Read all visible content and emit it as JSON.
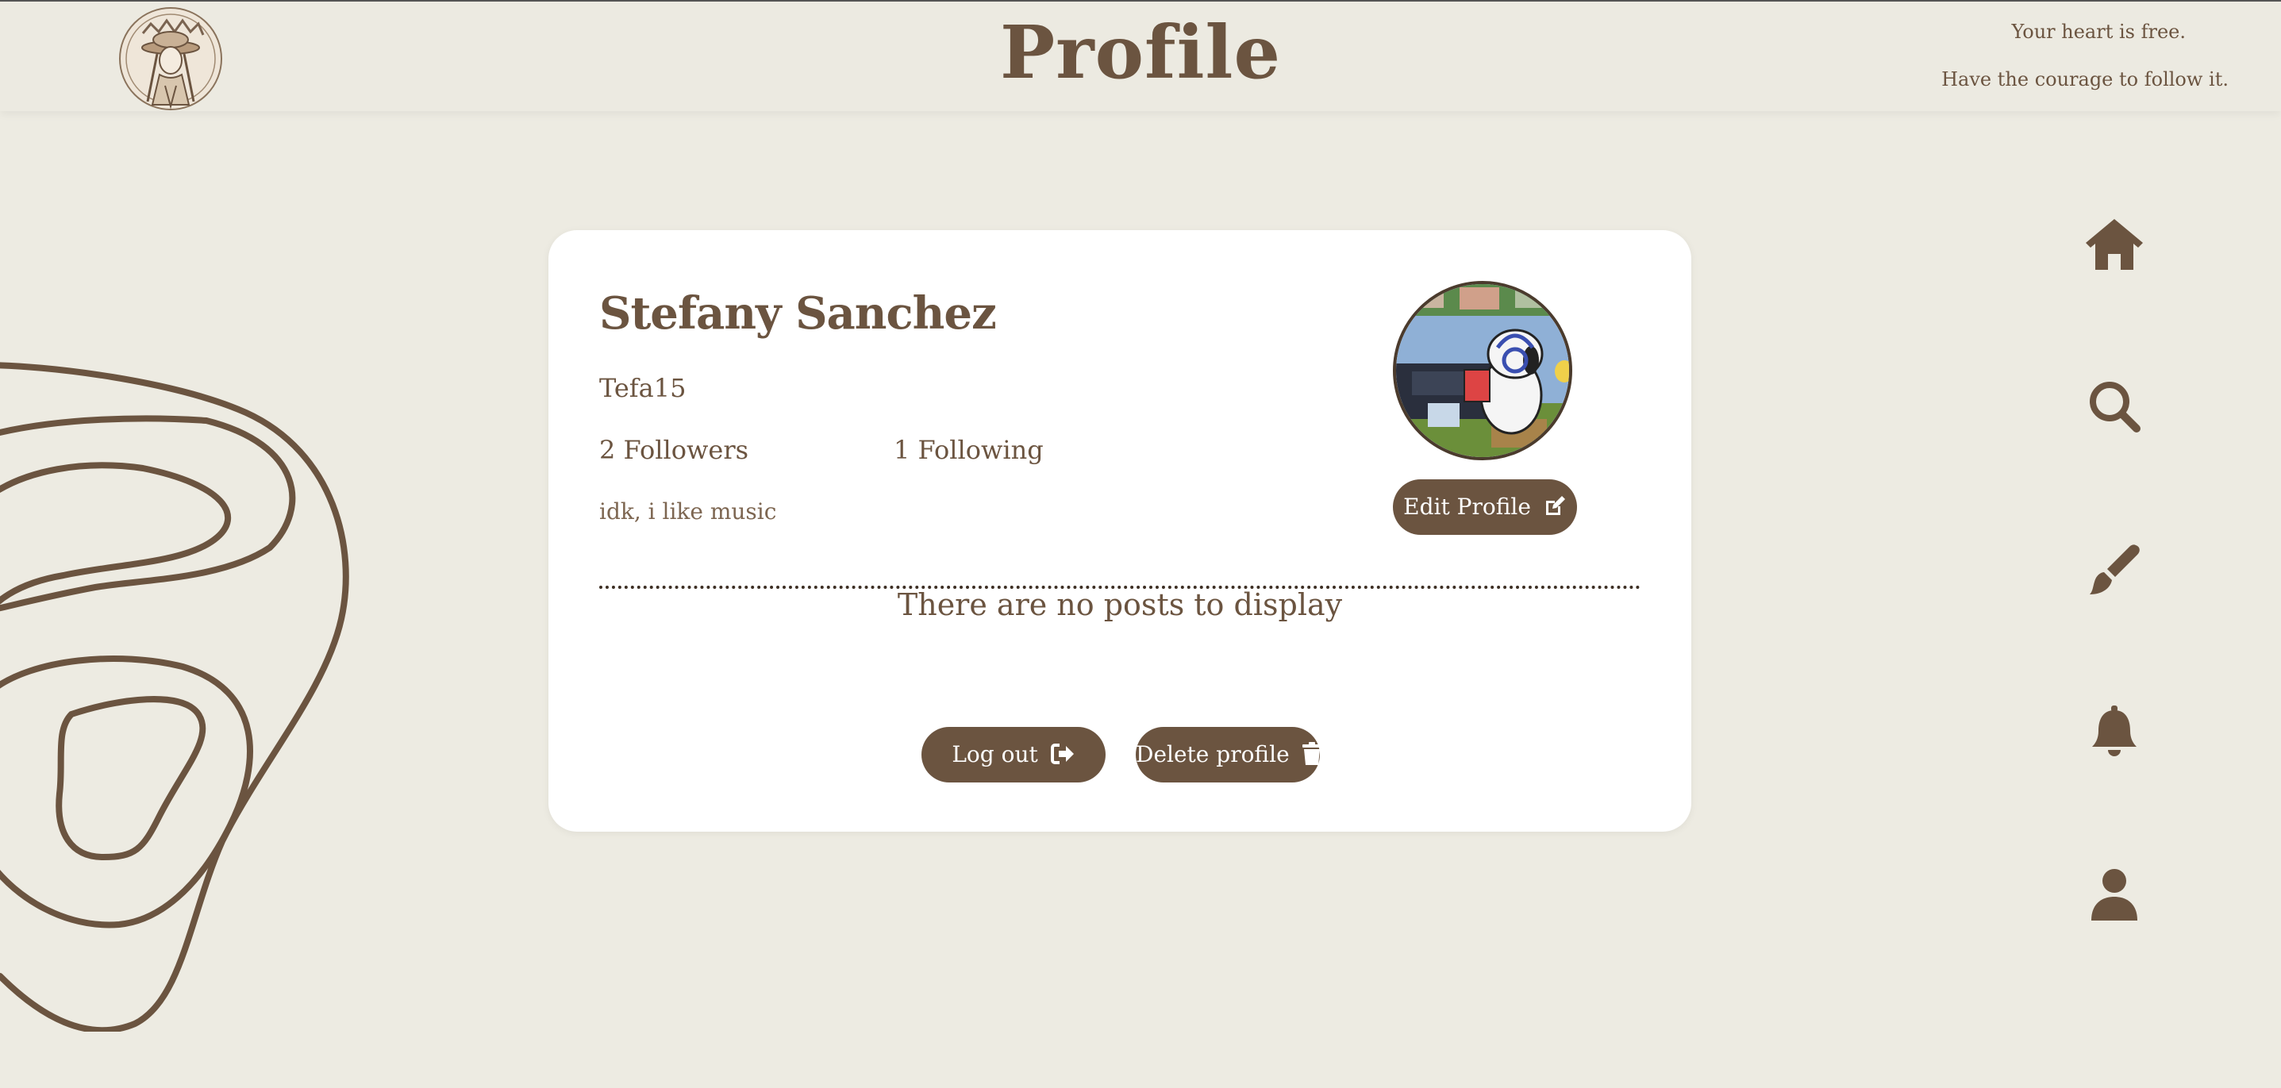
{
  "header": {
    "title": "Profile",
    "quote_line1": "Your heart is free.",
    "quote_line2": "Have the courage to follow it."
  },
  "profile": {
    "name": "Stefany Sanchez",
    "username": "Tefa15",
    "followers": "2 Followers",
    "following": "1 Following",
    "bio": "idk, i like music",
    "edit_label": "Edit Profile",
    "no_posts": "There are no posts to display"
  },
  "actions": {
    "logout_label": "Log out",
    "delete_label": "Delete profile"
  },
  "nav": {
    "items": [
      "home-icon",
      "search-icon",
      "brush-icon",
      "bell-icon",
      "user-icon"
    ]
  },
  "colors": {
    "background": "#edebe2",
    "brown": "#6b5440",
    "card": "#ffffff"
  }
}
